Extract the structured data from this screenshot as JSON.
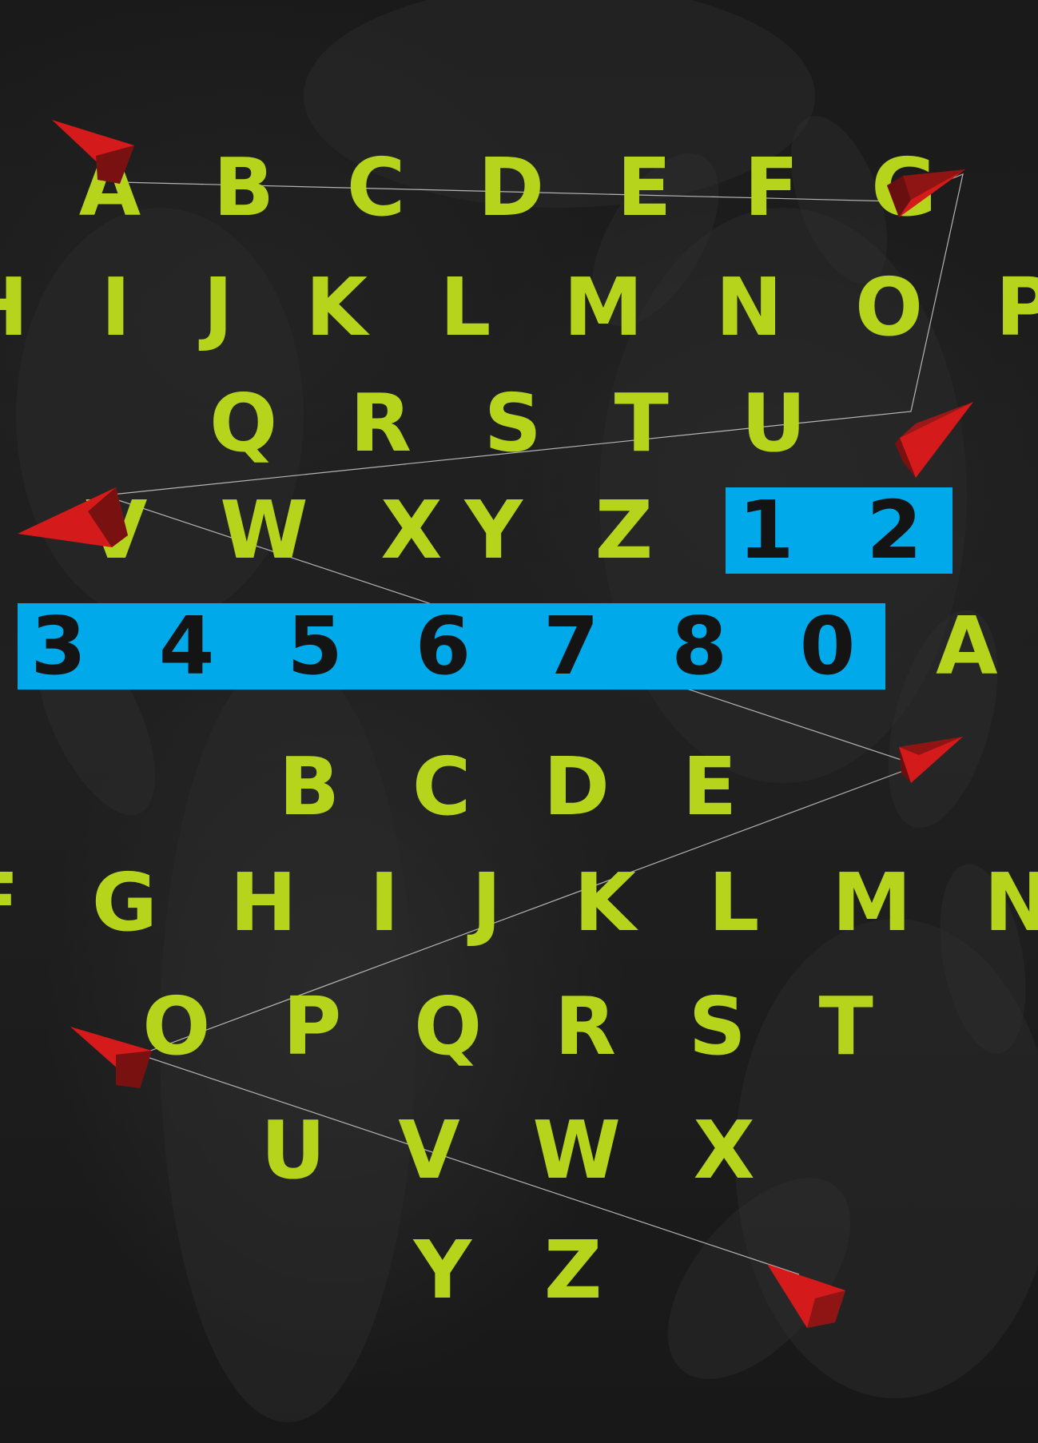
{
  "rows": [
    {
      "text": "A B C D E F G"
    },
    {
      "text": "H I J K L M N O P"
    },
    {
      "text": "Q R S T U"
    },
    {
      "text": "V W XY Z ",
      "highlight": "1 2"
    },
    {
      "highlight": "3 4 5 6 7 8 0",
      "text": " A"
    },
    {
      "text": "B C D E"
    },
    {
      "text": "F G H I J K L M N"
    },
    {
      "text": "O P Q R S T"
    },
    {
      "text": "U V W X"
    },
    {
      "text": "Y Z"
    }
  ],
  "colors": {
    "background": "#141414",
    "letters": "#b7d41c",
    "highlight_block": "#00a9ea",
    "highlight_text": "#141414",
    "kite": "#d41a1a",
    "kite_shade": "#7a1111",
    "string": "#d9d9d9"
  }
}
